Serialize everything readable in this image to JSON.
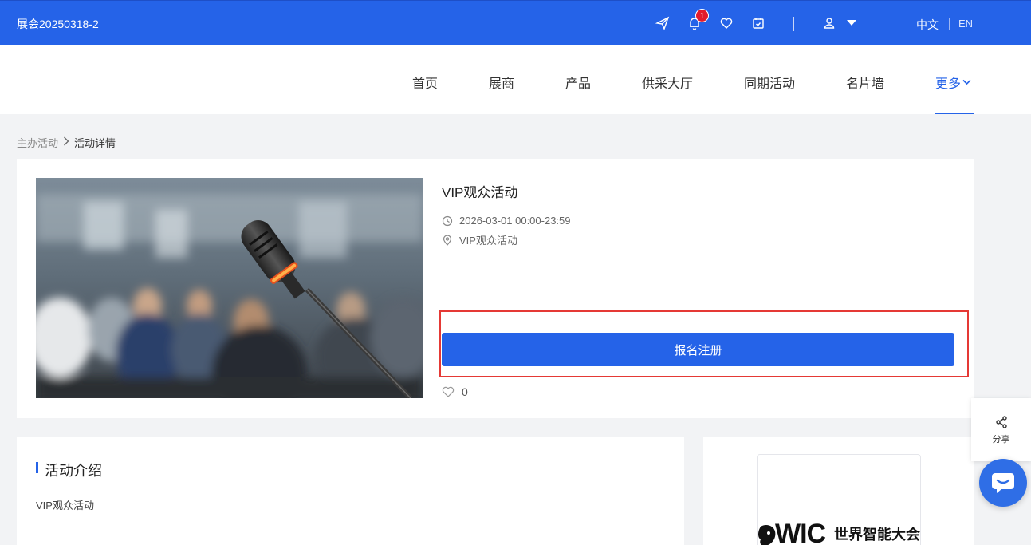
{
  "header": {
    "site_title": "展会20250318-2",
    "notification_count": "1",
    "lang_zh": "中文",
    "lang_en": "EN"
  },
  "nav": {
    "items": [
      "首页",
      "展商",
      "产品",
      "供采大厅",
      "同期活动",
      "名片墙"
    ],
    "more": "更多"
  },
  "breadcrumb": {
    "parent": "主办活动",
    "separator": ">",
    "current": "活动详情"
  },
  "event": {
    "title": "VIP观众活动",
    "datetime": "2026-03-01 00:00-23:59",
    "location": "VIP观众活动",
    "register_label": "报名注册",
    "likes": "0"
  },
  "intro": {
    "heading": "活动介绍",
    "text": "VIP观众活动"
  },
  "sponsor": {
    "logo_mark": "WIC",
    "logo_cn": "世界智能大会"
  },
  "floating": {
    "share_label": "分享"
  },
  "colors": {
    "primary": "#2563e8",
    "highlight": "#e53935",
    "badge": "#e21b2c"
  }
}
